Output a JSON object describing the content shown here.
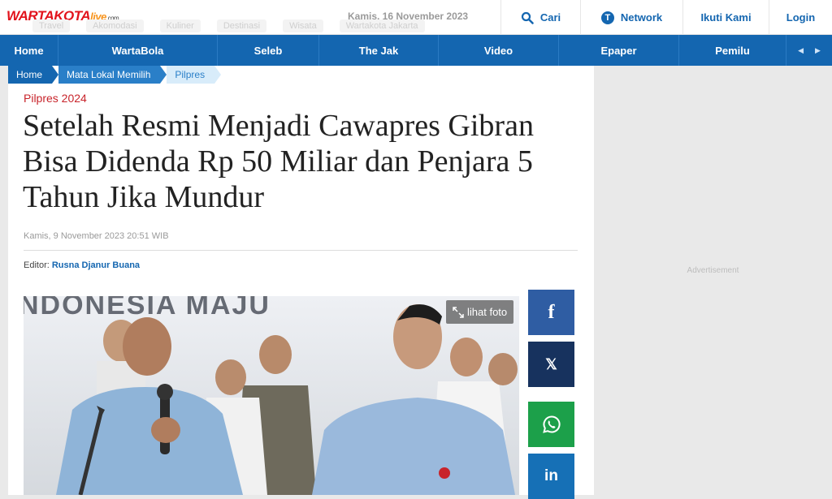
{
  "header": {
    "logo": {
      "main": "WARTAKOTA",
      "live": "live",
      "suffix": ".com"
    },
    "date": "Kamis, 16 November 2023",
    "ghost_links": [
      "Travel",
      "Akomodasi",
      "Kuliner",
      "Destinasi",
      "Wisata",
      "Wartakota Jakarta"
    ],
    "search_label": "Cari",
    "network_label": "Network",
    "follow_label": "Ikuti Kami",
    "login_label": "Login"
  },
  "mainnav": {
    "items": [
      "Home",
      "WartaBola",
      "Seleb",
      "The Jak",
      "Video",
      "Epaper",
      "Pemilu"
    ]
  },
  "breadcrumb": [
    "Home",
    "Mata Lokal Memilih",
    "Pilpres"
  ],
  "article": {
    "category": "Pilpres 2024",
    "title": "Setelah Resmi Menjadi Cawapres Gibran Bisa Didenda Rp 50 Miliar dan Penjara 5 Tahun Jika Mundur",
    "published": "Kamis, 9 November 2023 20:51 WIB",
    "editor_label": "Editor:",
    "editor_name": "Rusna Djanur Buana",
    "photo_banner_text": "NDONESIA MAJU",
    "view_photo_label": "lihat foto"
  },
  "share": {
    "facebook": "f",
    "x": "𝕏",
    "whatsapp": "whatsapp-icon",
    "linkedin": "in"
  },
  "sidebar": {
    "advertisement_label": "Advertisement"
  },
  "colors": {
    "brand_blue": "#1466b0",
    "brand_red": "#c8242b"
  }
}
